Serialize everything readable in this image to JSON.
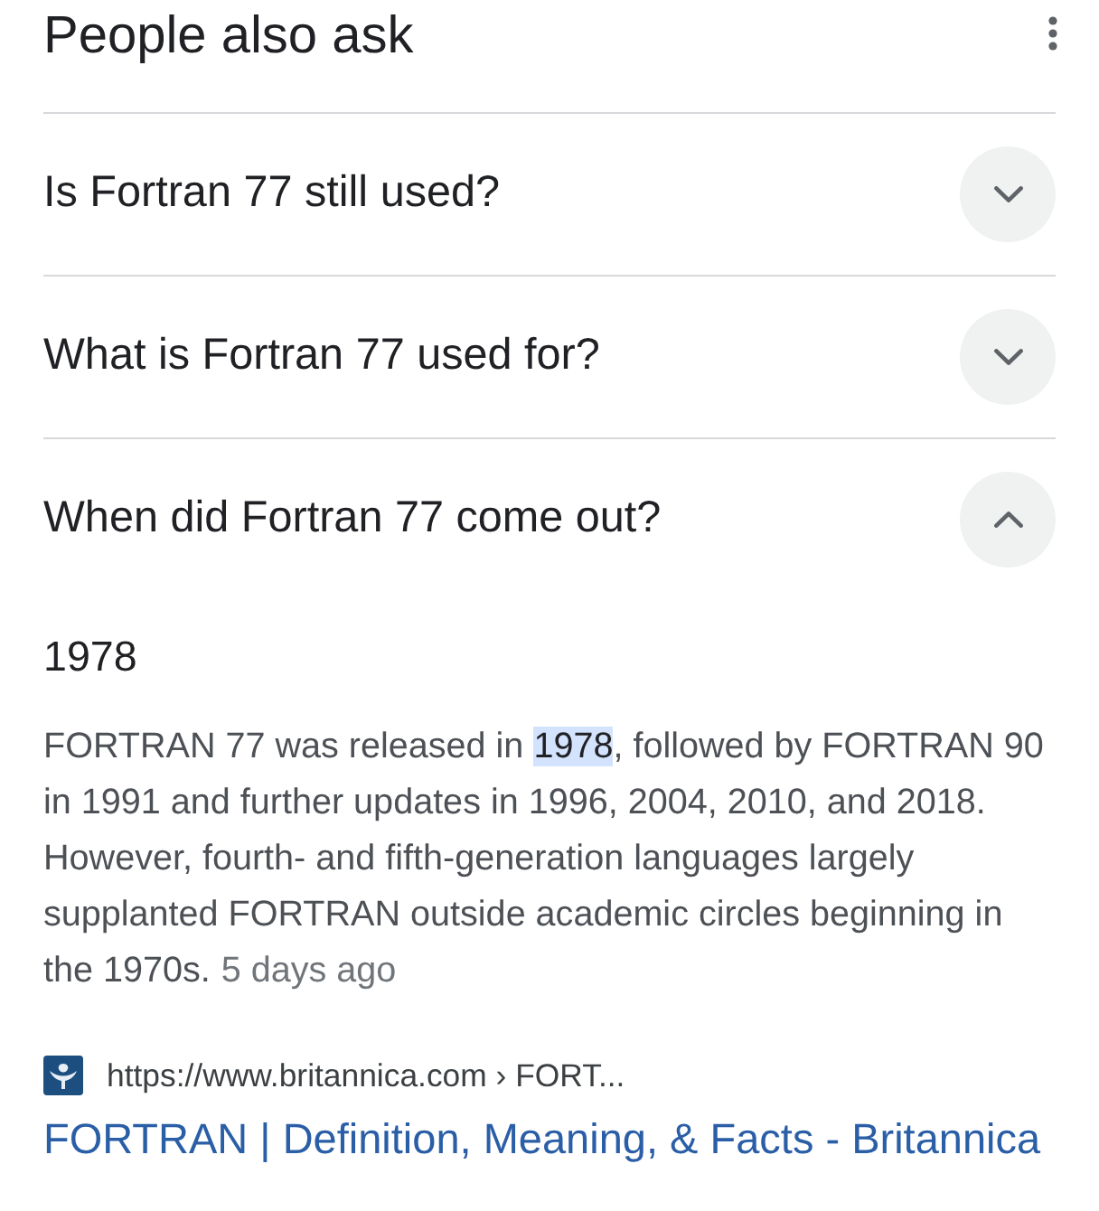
{
  "header": {
    "title": "People also ask"
  },
  "questions": [
    {
      "text": "Is Fortran 77 still used?",
      "expanded": false
    },
    {
      "text": "What is Fortran 77 used for?",
      "expanded": false
    },
    {
      "text": "When did Fortran 77 come out?",
      "expanded": true,
      "answer": {
        "heading": "1978",
        "text": "FORTRAN 77 was released in **1978**, followed by FORTRAN 90 in 1991 and further updates in 1996, 2004, 2010, and 2018. However, fourth- and fifth-generation languages largely supplanted FORTRAN outside academic circles beginning in the 1970s.",
        "date": "5 days ago",
        "source": {
          "url": "https://www.britannica.com › FORT...",
          "title": "FORTRAN | Definition, Meaning, & Facts - Britannica"
        }
      }
    }
  ]
}
